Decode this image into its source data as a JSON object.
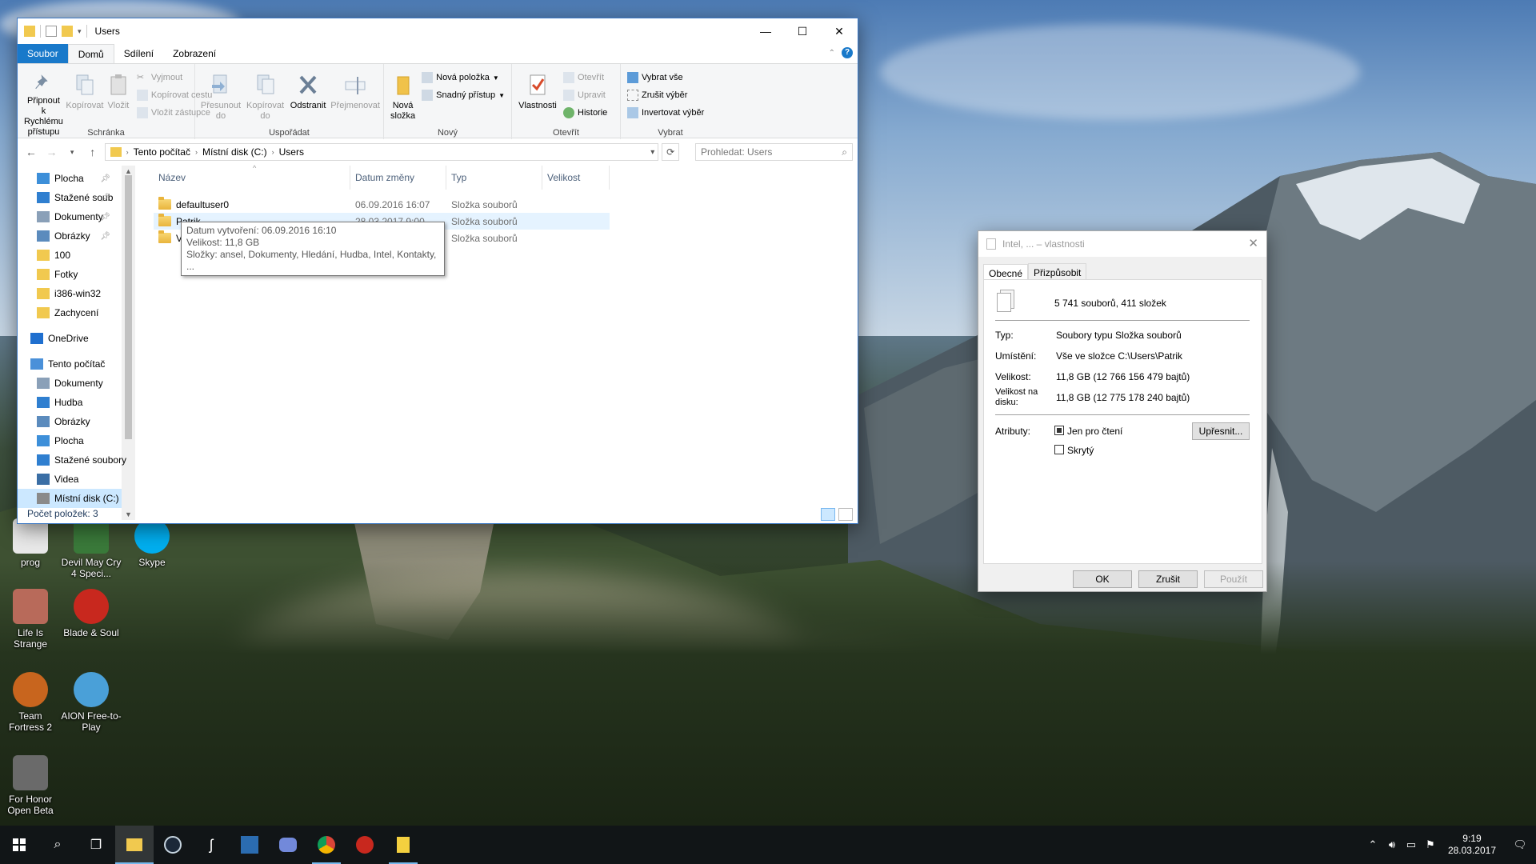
{
  "explorer": {
    "title": "Users",
    "ribbon_tabs": [
      "Soubor",
      "Domů",
      "Sdílení",
      "Zobrazení"
    ],
    "ribbon": {
      "clipboard": {
        "label": "Schránka",
        "pin": "Připnout k Rychlému přístupu",
        "copy": "Kopírovat",
        "paste": "Vložit",
        "cut": "Vyjmout",
        "copy_path": "Kopírovat cestu",
        "paste_shortcut": "Vložit zástupce"
      },
      "organize": {
        "label": "Uspořádat",
        "move_to": "Přesunout do",
        "copy_to": "Kopírovat do",
        "delete": "Odstranit",
        "rename": "Přejmenovat"
      },
      "new": {
        "label": "Nový",
        "new_folder": "Nová složka",
        "new_item": "Nová položka",
        "easy_access": "Snadný přístup"
      },
      "open": {
        "label": "Otevřít",
        "properties": "Vlastnosti",
        "open": "Otevřít",
        "edit": "Upravit",
        "history": "Historie"
      },
      "select": {
        "label": "Vybrat",
        "select_all": "Vybrat vše",
        "select_none": "Zrušit výběr",
        "invert": "Invertovat výběr"
      }
    },
    "address": {
      "segments": [
        "Tento počítač",
        "Místní disk (C:)",
        "Users"
      ],
      "search_placeholder": "Prohledat: Users"
    },
    "nav_pane": [
      {
        "label": "Plocha",
        "icon": "desktop-icon",
        "pinned": true
      },
      {
        "label": "Stažené soub",
        "icon": "download-icon",
        "pinned": true
      },
      {
        "label": "Dokumenty",
        "icon": "documents-icon",
        "pinned": true
      },
      {
        "label": "Obrázky",
        "icon": "pictures-icon",
        "pinned": true
      },
      {
        "label": "100",
        "icon": "folder-icon",
        "pinned": false
      },
      {
        "label": "Fotky",
        "icon": "folder-icon",
        "pinned": false
      },
      {
        "label": "i386-win32",
        "icon": "folder-icon",
        "pinned": false
      },
      {
        "label": "Zachycení",
        "icon": "folder-icon",
        "pinned": false
      },
      {
        "label": "OneDrive",
        "icon": "onedrive-icon",
        "pinned": false
      },
      {
        "label": "Tento počítač",
        "icon": "computer-icon",
        "pinned": false
      },
      {
        "label": "Dokumenty",
        "icon": "documents-icon",
        "pinned": false
      },
      {
        "label": "Hudba",
        "icon": "music-icon",
        "pinned": false
      },
      {
        "label": "Obrázky",
        "icon": "pictures-icon",
        "pinned": false
      },
      {
        "label": "Plocha",
        "icon": "desktop-icon",
        "pinned": false
      },
      {
        "label": "Stažené soubory",
        "icon": "download-icon",
        "pinned": false
      },
      {
        "label": "Videa",
        "icon": "videos-icon",
        "pinned": false
      },
      {
        "label": "Místní disk (C:)",
        "icon": "drive-icon",
        "pinned": false
      }
    ],
    "columns": [
      "Název",
      "Datum změny",
      "Typ",
      "Velikost"
    ],
    "files": [
      {
        "name": "defaultuser0",
        "date": "06.09.2016 16:07",
        "type": "Složka souborů"
      },
      {
        "name": "Patrik",
        "date": "28.03.2017 9:00",
        "type": "Složka souborů"
      },
      {
        "name": "V",
        "date": "",
        "type": "Složka souborů"
      }
    ],
    "tooltip": {
      "created": "Datum vytvoření: 06.09.2016 16:10",
      "size": "Velikost: 11,8 GB",
      "folders": "Složky: ansel, Dokumenty, Hledání, Hudba, Intel, Kontakty, ..."
    },
    "status": "Počet položek: 3"
  },
  "properties": {
    "title": "Intel, ... – vlastnosti",
    "tabs": [
      "Obecné",
      "Přizpůsobit"
    ],
    "summary": "5 741 souborů, 411 složek",
    "type_label": "Typ:",
    "type_value": "Soubory typu Složka souborů",
    "location_label": "Umístění:",
    "location_value": "Vše ve složce C:\\Users\\Patrik",
    "size_label": "Velikost:",
    "size_value": "11,8 GB (12 766 156 479 bajtů)",
    "disk_label": "Velikost na disku:",
    "disk_value": "11,8 GB (12 775 178 240 bajtů)",
    "attr_label": "Atributy:",
    "readonly": "Jen pro čtení",
    "hidden": "Skrytý",
    "advanced": "Upřesnit...",
    "ok": "OK",
    "cancel": "Zrušit",
    "apply": "Použít"
  },
  "desktop_icons": [
    {
      "label": "prog"
    },
    {
      "label": "Devil May Cry 4 Speci..."
    },
    {
      "label": "Skype"
    },
    {
      "label": "Life Is Strange"
    },
    {
      "label": "Blade & Soul"
    },
    {
      "label": "Team Fortress 2"
    },
    {
      "label": "AION Free-to-Play"
    },
    {
      "label": "For Honor Open Beta"
    }
  ],
  "taskbar": {
    "time": "9:19",
    "date": "28.03.2017"
  },
  "colors": {
    "accent": "#1979ca",
    "selection": "#cce8ff",
    "taskbar": "#101418"
  }
}
